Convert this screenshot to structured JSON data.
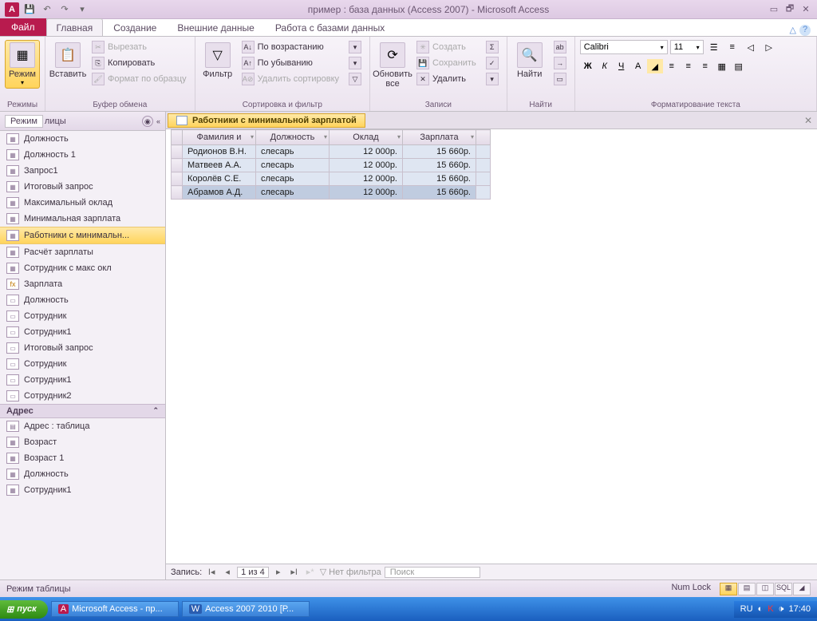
{
  "window": {
    "title": "пример : база данных (Access 2007)  -  Microsoft Access"
  },
  "ribbon": {
    "file": "Файл",
    "tabs": [
      "Главная",
      "Создание",
      "Внешние данные",
      "Работа с базами данных"
    ],
    "active_tab": 0,
    "groups": {
      "view": {
        "label": "Режимы",
        "btn": "Режим"
      },
      "clipboard": {
        "label": "Буфер обмена",
        "paste": "Вставить",
        "cut": "Вырезать",
        "copy": "Копировать",
        "format": "Формат по образцу"
      },
      "sort": {
        "label": "Сортировка и фильтр",
        "filter": "Фильтр",
        "asc": "По возрастанию",
        "desc": "По убыванию",
        "remove": "Удалить сортировку"
      },
      "records": {
        "label": "Записи",
        "refresh": "Обновить все",
        "new": "Создать",
        "save": "Сохранить",
        "delete": "Удалить"
      },
      "find": {
        "label": "Найти",
        "find_btn": "Найти"
      },
      "format": {
        "label": "Форматирование текста",
        "font": "Calibri",
        "size": "11"
      }
    }
  },
  "nav": {
    "mode_label": "Режим",
    "header": "лицы",
    "group_addr": "Адрес",
    "items_top": [
      "Должность",
      "Должность 1",
      "Запрос1",
      "Итоговый запрос",
      "Максимальный оклад",
      "Минимальная зарплата",
      "Работники с минимальн...",
      "Расчёт зарплаты",
      "Сотрудник с макс окл",
      "Зарплата",
      "Должность",
      "Сотрудник",
      "Сотрудник1",
      "Итоговый запрос",
      "Сотрудник",
      "Сотрудник1",
      "Сотрудник2"
    ],
    "items_addr": [
      "Адрес : таблица",
      "Возраст",
      "Возраст 1",
      "Должность",
      "Сотрудник1"
    ],
    "selected": 6
  },
  "doc": {
    "tab_title": "Работники с минимальной зарплатой",
    "columns": [
      "Фамилия и",
      "Должность",
      "Оклад",
      "Зарплата"
    ],
    "rows": [
      [
        "Родионов В.Н.",
        "слесарь",
        "12 000р.",
        "15 660р."
      ],
      [
        "Матвеев А.А.",
        "слесарь",
        "12 000р.",
        "15 660р."
      ],
      [
        "Королёв С.Е.",
        "слесарь",
        "12 000р.",
        "15 660р."
      ],
      [
        "Абрамов А.Д.",
        "слесарь",
        "12 000р.",
        "15 660р."
      ]
    ],
    "rec_nav": {
      "label": "Запись:",
      "pos": "1 из 4",
      "no_filter": "Нет фильтра",
      "search": "Поиск"
    }
  },
  "status": {
    "mode": "Режим таблицы",
    "numlock": "Num Lock"
  },
  "taskbar": {
    "start": "пуск",
    "tasks": [
      "Microsoft Access - пр...",
      "Access 2007 2010 [Р..."
    ],
    "lang": "RU",
    "time": "17:40"
  }
}
